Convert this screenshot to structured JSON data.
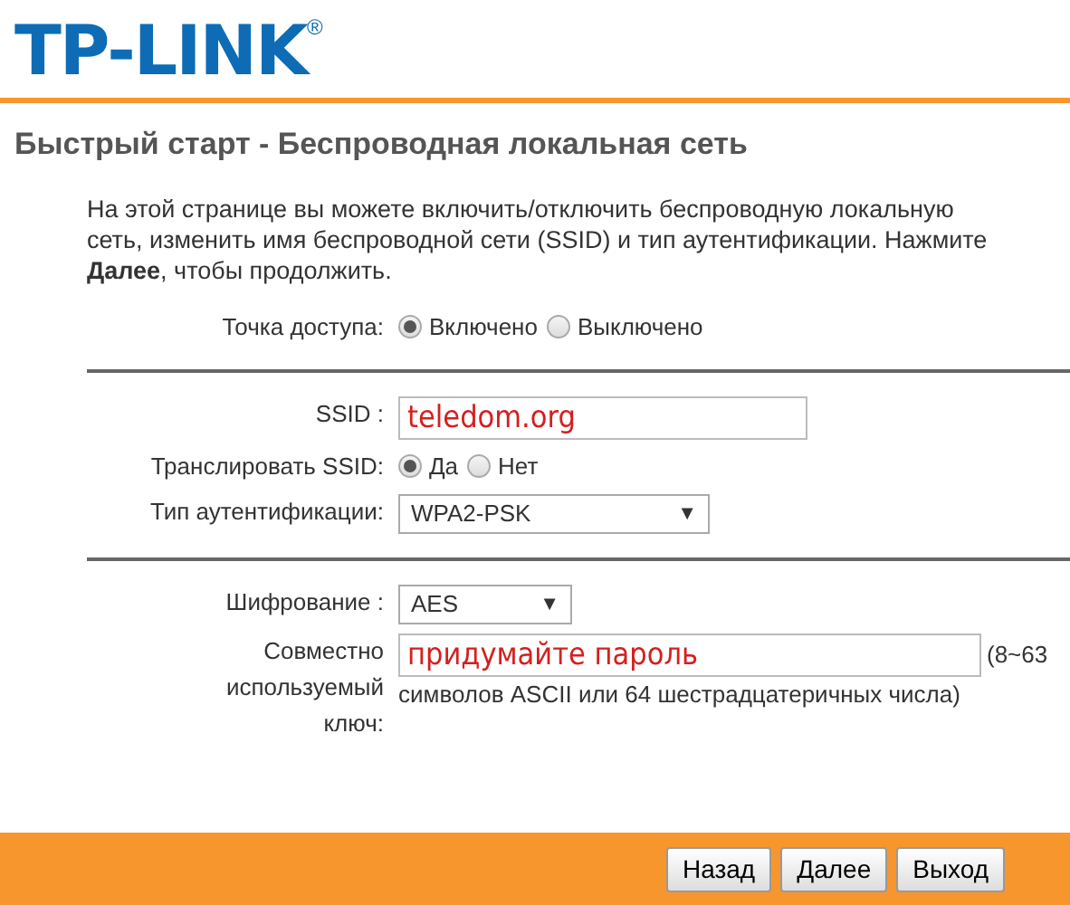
{
  "logo": {
    "text": "TP-LINK",
    "mark": "®"
  },
  "title": "Быстрый старт - Беспроводная локальная сеть",
  "intro": "На этой странице вы можете включить/отключить беспроводную локальную сеть, изменить имя беспроводной сети (SSID) и тип аутентификации. Нажмите **Далее**, чтобы продолжить.",
  "sections": [
    [
      {
        "kind": "radio",
        "label": "Точка доступа:",
        "options": [
          {
            "label": "Включено",
            "selected": true
          },
          {
            "label": "Выключено",
            "selected": false
          }
        ]
      }
    ],
    [
      {
        "kind": "text",
        "label": "SSID :",
        "value": "teledom.org"
      },
      {
        "kind": "radio",
        "label": "Транслировать SSID:",
        "options": [
          {
            "label": "Да",
            "selected": true
          },
          {
            "label": "Нет",
            "selected": false
          }
        ]
      },
      {
        "kind": "select",
        "label": "Тип аутентификации:",
        "value": "WPA2-PSK",
        "arrow": "▼"
      }
    ],
    [
      {
        "kind": "select",
        "label": "Шифрование :",
        "value": "AES",
        "arrow": "▼"
      },
      {
        "kind": "text",
        "label": "Совместно используемый ключ:",
        "value": "придумайте пароль",
        "hint": [
          "(8~63",
          "символов ASCII или 64 шестрадцатеричных числа)"
        ]
      }
    ]
  ],
  "buttons": [
    "Назад",
    "Далее",
    "Выход"
  ]
}
